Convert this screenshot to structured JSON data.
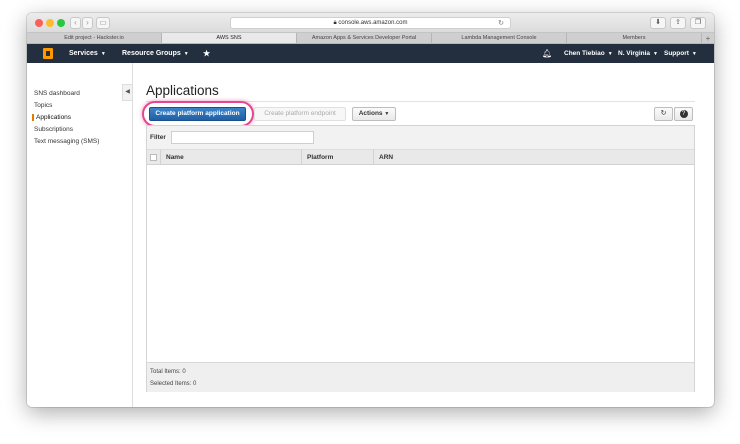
{
  "browser": {
    "url": "console.aws.amazon.com",
    "tabs": [
      {
        "label": "Edit project - Hackster.io",
        "active": false
      },
      {
        "label": "AWS SNS",
        "active": true
      },
      {
        "label": "Amazon Apps & Services Developer Portal",
        "active": false
      },
      {
        "label": "Lambda Management Console",
        "active": false
      },
      {
        "label": "Members",
        "active": false
      }
    ]
  },
  "topnav": {
    "services": "Services",
    "resource_groups": "Resource Groups",
    "user": "Chen Tiebiao",
    "region": "N. Virginia",
    "support": "Support",
    "icons": [
      "aws-cube-icon",
      "pin-icon",
      "bell-icon"
    ]
  },
  "sidebar": {
    "items": [
      {
        "label": "SNS dashboard",
        "active": false
      },
      {
        "label": "Topics",
        "active": false
      },
      {
        "label": "Applications",
        "active": true
      },
      {
        "label": "Subscriptions",
        "active": false
      },
      {
        "label": "Text messaging (SMS)",
        "active": false
      }
    ]
  },
  "page": {
    "title": "Applications"
  },
  "toolbar": {
    "create_label": "Create platform application",
    "endpoint_label": "Create platform endpoint",
    "actions_label": "Actions"
  },
  "table": {
    "filter_label": "Filter",
    "filter_value": "",
    "columns": [
      "Name",
      "Platform",
      "ARN"
    ],
    "rows": [],
    "total_items": "Total Items: 0",
    "selected_items": "Selected Items: 0"
  },
  "colors": {
    "nav_bg": "#232f3e",
    "primary_button": "#1f5fa6",
    "highlight": "#e2478f",
    "active_side": "#e07b00"
  }
}
